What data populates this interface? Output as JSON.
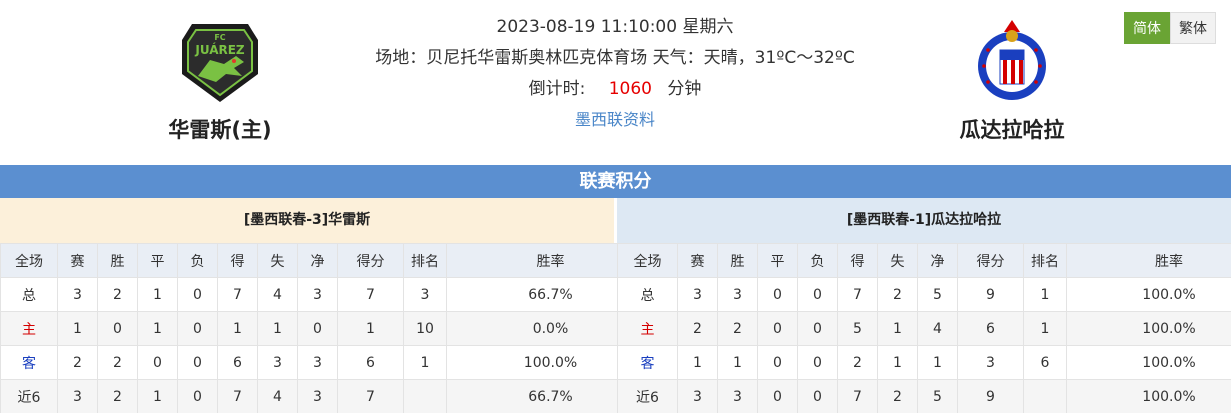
{
  "header": {
    "datetime": "2023-08-19 11:10:00 星期六",
    "venue_line": "场地：贝尼托华雷斯奥林匹克体育场 天气：天晴，31ºC～32ºC",
    "countdown_label": "倒计时:",
    "countdown_value": "1060",
    "countdown_unit": "分钟",
    "league_link": "墨西联资料"
  },
  "home_team": {
    "name": "华雷斯(主)",
    "logo_icon": "fc-juarez-logo"
  },
  "away_team": {
    "name": "瓜达拉哈拉",
    "logo_icon": "chivas-guadalajara-logo"
  },
  "lang": {
    "simplified": "简体",
    "traditional": "繁体"
  },
  "standings": {
    "title": "联赛积分",
    "columns": [
      "全场",
      "赛",
      "胜",
      "平",
      "负",
      "得",
      "失",
      "净",
      "得分",
      "排名",
      "胜率"
    ],
    "home": {
      "caption": "[墨西联春-3]华雷斯",
      "rows": [
        [
          "总",
          "3",
          "2",
          "1",
          "0",
          "7",
          "4",
          "3",
          "7",
          "3",
          "66.7%"
        ],
        [
          "主",
          "1",
          "0",
          "1",
          "0",
          "1",
          "1",
          "0",
          "1",
          "10",
          "0.0%"
        ],
        [
          "客",
          "2",
          "2",
          "0",
          "0",
          "6",
          "3",
          "3",
          "6",
          "1",
          "100.0%"
        ],
        [
          "近6",
          "3",
          "2",
          "1",
          "0",
          "7",
          "4",
          "3",
          "7",
          "",
          "66.7%"
        ]
      ]
    },
    "away": {
      "caption": "[墨西联春-1]瓜达拉哈拉",
      "rows": [
        [
          "总",
          "3",
          "3",
          "0",
          "0",
          "7",
          "2",
          "5",
          "9",
          "1",
          "100.0%"
        ],
        [
          "主",
          "2",
          "2",
          "0",
          "0",
          "5",
          "1",
          "4",
          "6",
          "1",
          "100.0%"
        ],
        [
          "客",
          "1",
          "1",
          "0",
          "0",
          "2",
          "1",
          "1",
          "3",
          "6",
          "100.0%"
        ],
        [
          "近6",
          "3",
          "3",
          "0",
          "0",
          "7",
          "2",
          "5",
          "9",
          "",
          "100.0%"
        ]
      ]
    }
  },
  "colors": {
    "accent_bar": "#5b8fd0",
    "home_caption_bg": "#fcf0da",
    "away_caption_bg": "#dde8f3",
    "countdown": "#e60000",
    "active_lang": "#6aa434"
  }
}
